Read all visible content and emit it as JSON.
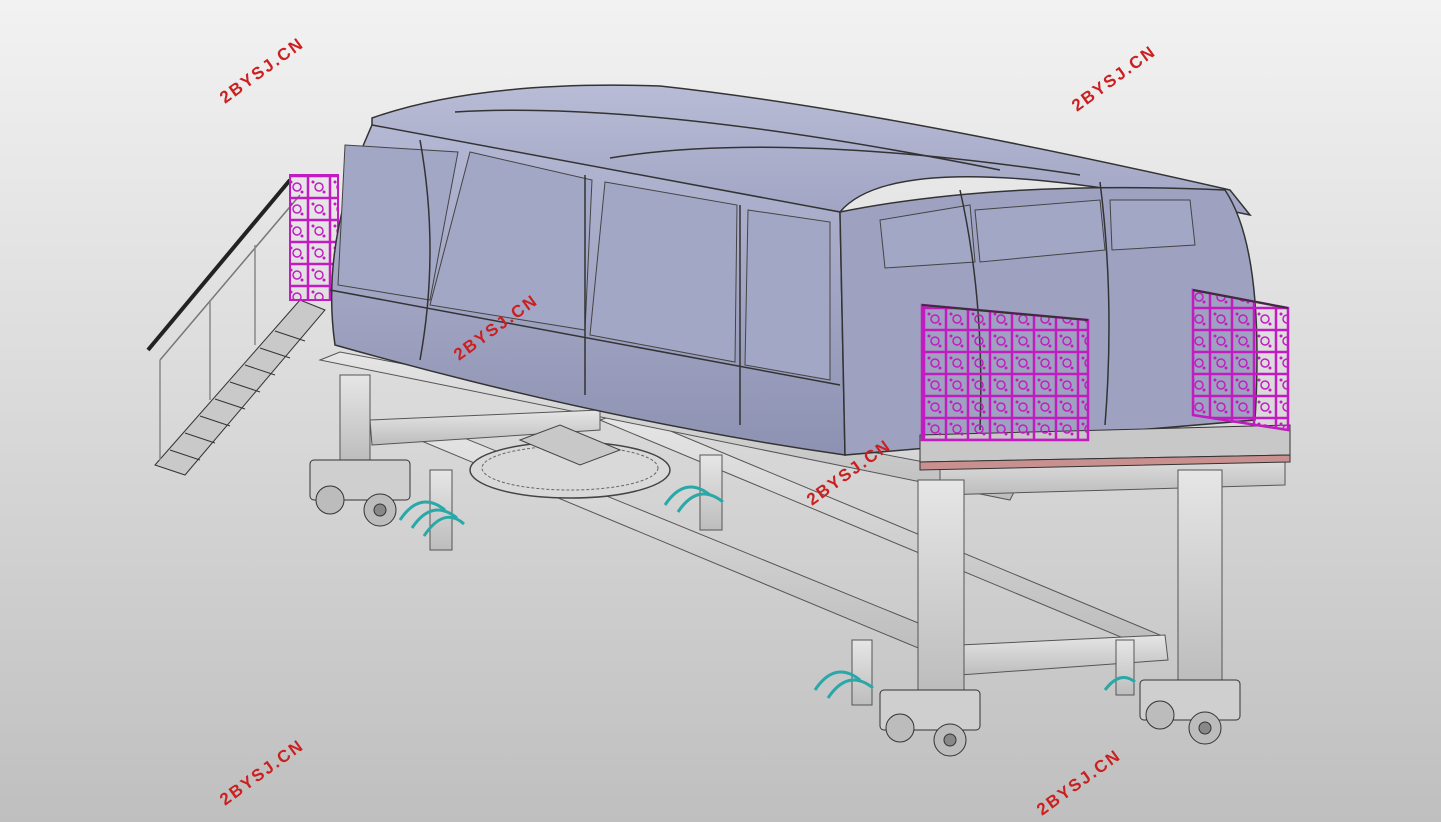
{
  "watermark": {
    "text": "2BYSJ.CN",
    "color": "#cc1f1f"
  },
  "colors": {
    "background_top": "#f2f2f2",
    "background_bottom": "#bfbfbf",
    "cabin": "#a7aac8",
    "cabin_dark": "#8f93b3",
    "frame": "#d6d6d6",
    "railing_guard": "#c21bc2",
    "wheel_guard": "#2aa8a8"
  },
  "icons": {
    "watermark": "text-watermark",
    "model": "cad-3d-model"
  }
}
